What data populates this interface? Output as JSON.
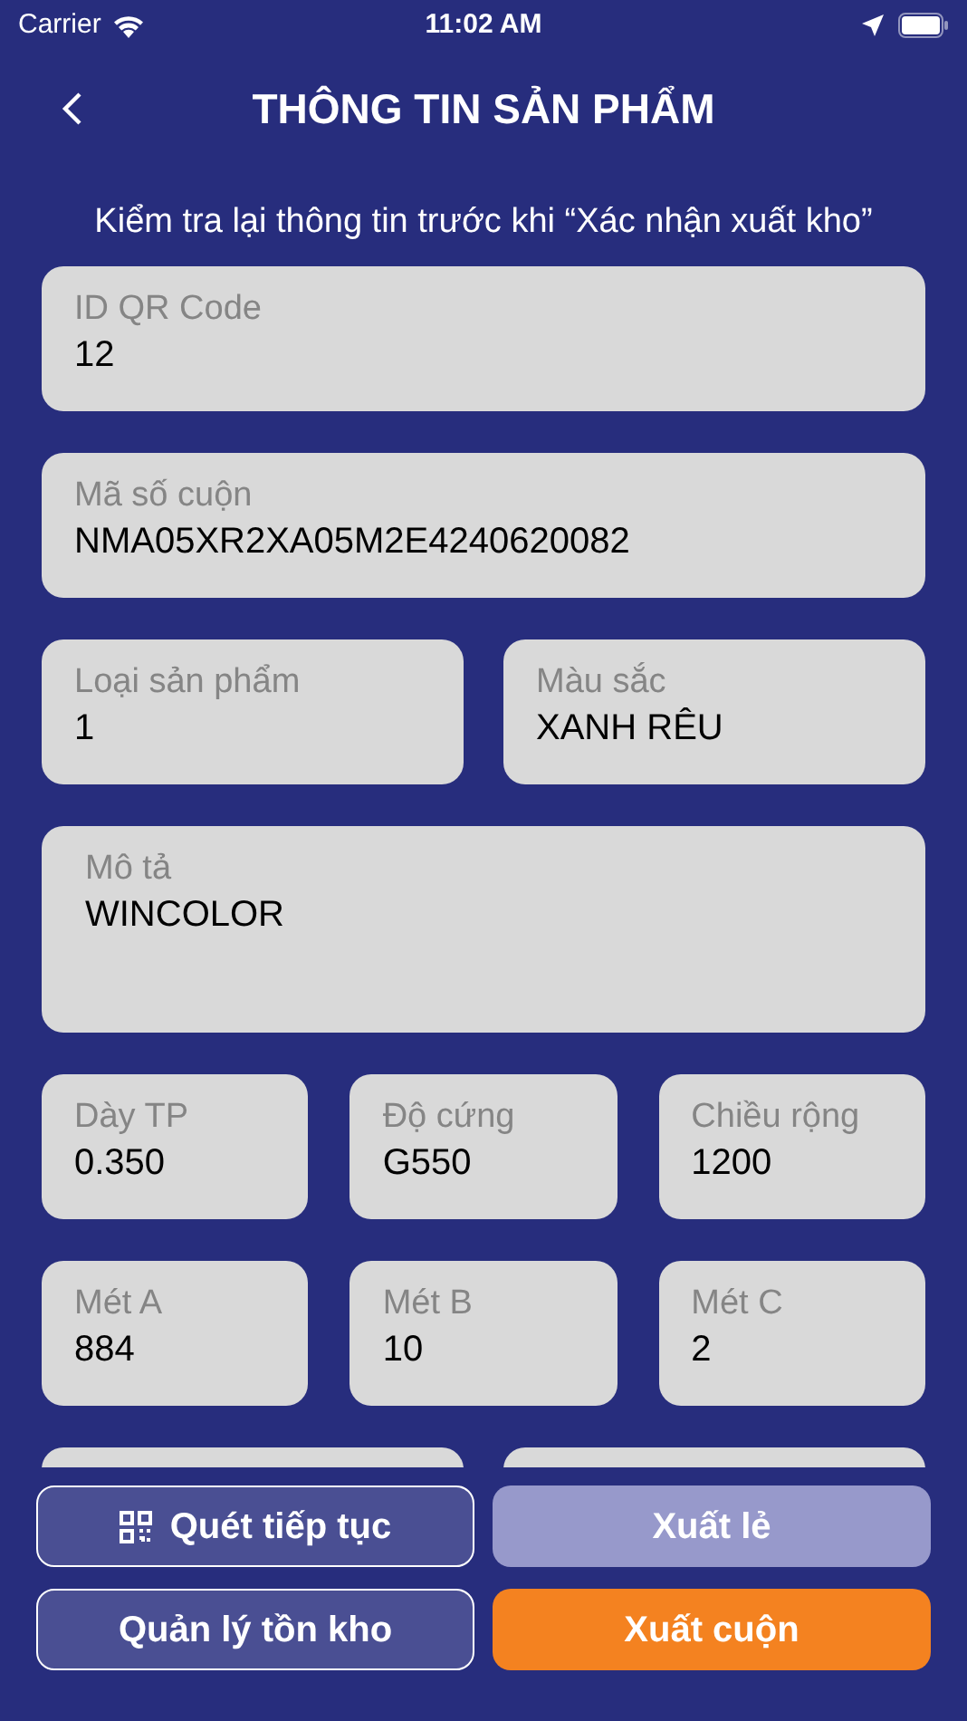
{
  "status_bar": {
    "carrier": "Carrier",
    "time": "11:02 AM"
  },
  "header": {
    "title": "THÔNG TIN SẢN PHẨM"
  },
  "subtitle": "Kiểm tra lại thông tin trước khi “Xác nhận xuất kho”",
  "rows": [
    [
      {
        "label": "ID QR Code",
        "value": "12"
      }
    ],
    [
      {
        "label": "Mã số cuộn",
        "value": "NMA05XR2XA05M2E4240620082"
      }
    ],
    [
      {
        "label": "Loại sản phẩm",
        "value": "1"
      },
      {
        "label": "Màu sắc",
        "value": "XANH RÊU"
      }
    ],
    [
      {
        "label": "Mô tả",
        "value": "WINCOLOR",
        "kind": "multiline"
      }
    ],
    [
      {
        "label": "Dày TP",
        "value": "0.350"
      },
      {
        "label": "Độ cứng",
        "value": "G550"
      },
      {
        "label": "Chiều rộng",
        "value": "1200"
      }
    ],
    [
      {
        "label": "Mét A",
        "value": "884"
      },
      {
        "label": "Mét B",
        "value": "10"
      },
      {
        "label": "Mét C",
        "value": "2"
      }
    ],
    [
      {
        "kind": "cut"
      },
      {
        "kind": "cut"
      }
    ]
  ],
  "buttons": [
    {
      "label": "Quét tiếp tục",
      "kind": "scan"
    },
    {
      "label": "Xuất lẻ",
      "kind": "muted"
    },
    {
      "label": "Quản lý tồn kho",
      "kind": "outline"
    },
    {
      "label": "Xuất cuộn",
      "kind": "primary"
    }
  ]
}
